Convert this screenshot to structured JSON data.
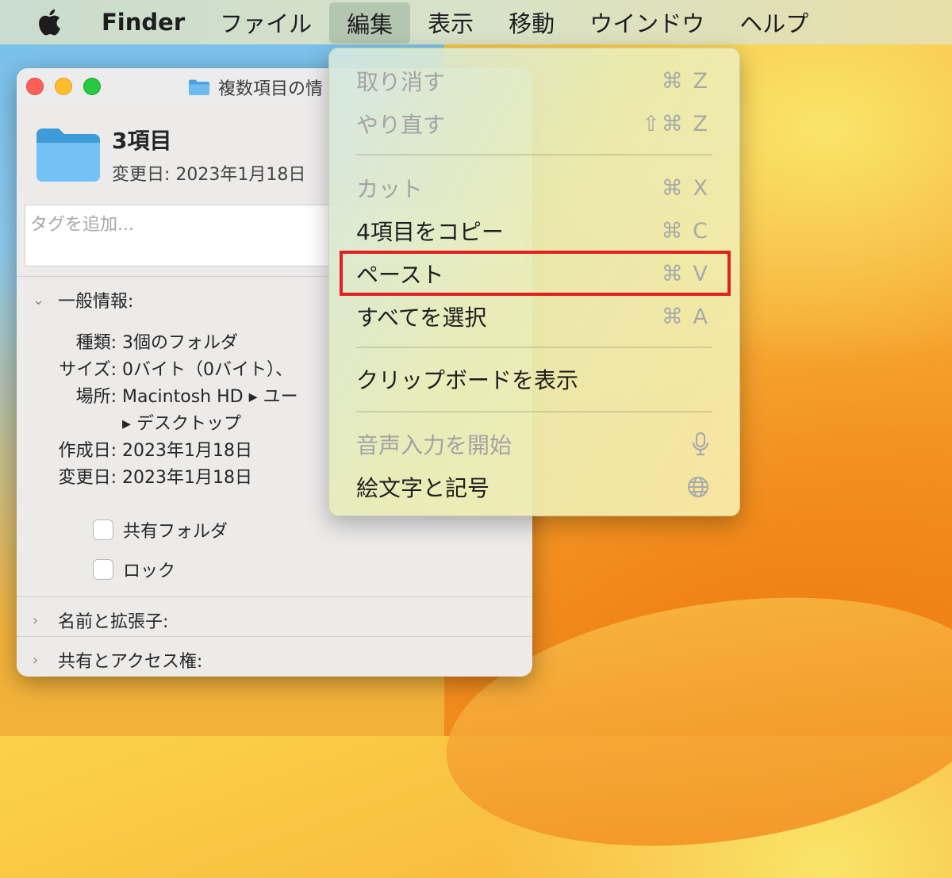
{
  "menubar": {
    "app_name": "Finder",
    "items": [
      "ファイル",
      "編集",
      "表示",
      "移動",
      "ウインドウ",
      "ヘルプ"
    ],
    "active": "編集"
  },
  "info_window": {
    "title": "複数項目の情",
    "item_name": "3項目",
    "modified_header": "変更日: 2023年1月18日",
    "tags_placeholder": "タグを追加...",
    "general_section": "一般情報:",
    "rows": [
      {
        "key": "種類:",
        "value": "3個のフォルダ"
      },
      {
        "key": "サイズ:",
        "value": "0バイト（0バイト）、"
      },
      {
        "key": "場所:",
        "value": "Macintosh HD ▸ ユー"
      },
      {
        "key": "",
        "value": "▸ デスクトップ"
      },
      {
        "key": "作成日:",
        "value": "2023年1月18日"
      },
      {
        "key": "変更日:",
        "value": "2023年1月18日"
      }
    ],
    "checkbox_shared": "共有フォルダ",
    "checkbox_lock": "ロック",
    "section_name_ext": "名前と拡張子:",
    "section_sharing": "共有とアクセス権:"
  },
  "edit_menu": {
    "items": [
      {
        "label": "取り消す",
        "shortcut": "⌘ Z",
        "disabled": true
      },
      {
        "label": "やり直す",
        "shortcut": "⇧⌘ Z",
        "disabled": true
      },
      {
        "label": "カット",
        "shortcut": "⌘ X",
        "disabled": true
      },
      {
        "label": "4項目をコピー",
        "shortcut": "⌘ C",
        "disabled": false
      },
      {
        "label": "ペースト",
        "shortcut": "⌘ V",
        "disabled": false,
        "highlighted": true
      },
      {
        "label": "すべてを選択",
        "shortcut": "⌘ A",
        "disabled": false
      },
      {
        "label": "クリップボードを表示",
        "shortcut": "",
        "disabled": false
      },
      {
        "label": "音声入力を開始",
        "shortcut_icon": "microphone-icon",
        "disabled": true
      },
      {
        "label": "絵文字と記号",
        "shortcut_icon": "globe-icon",
        "disabled": false
      }
    ]
  },
  "colors": {
    "highlight_border": "#e02020",
    "disabled_text": "#a3a3a3"
  }
}
